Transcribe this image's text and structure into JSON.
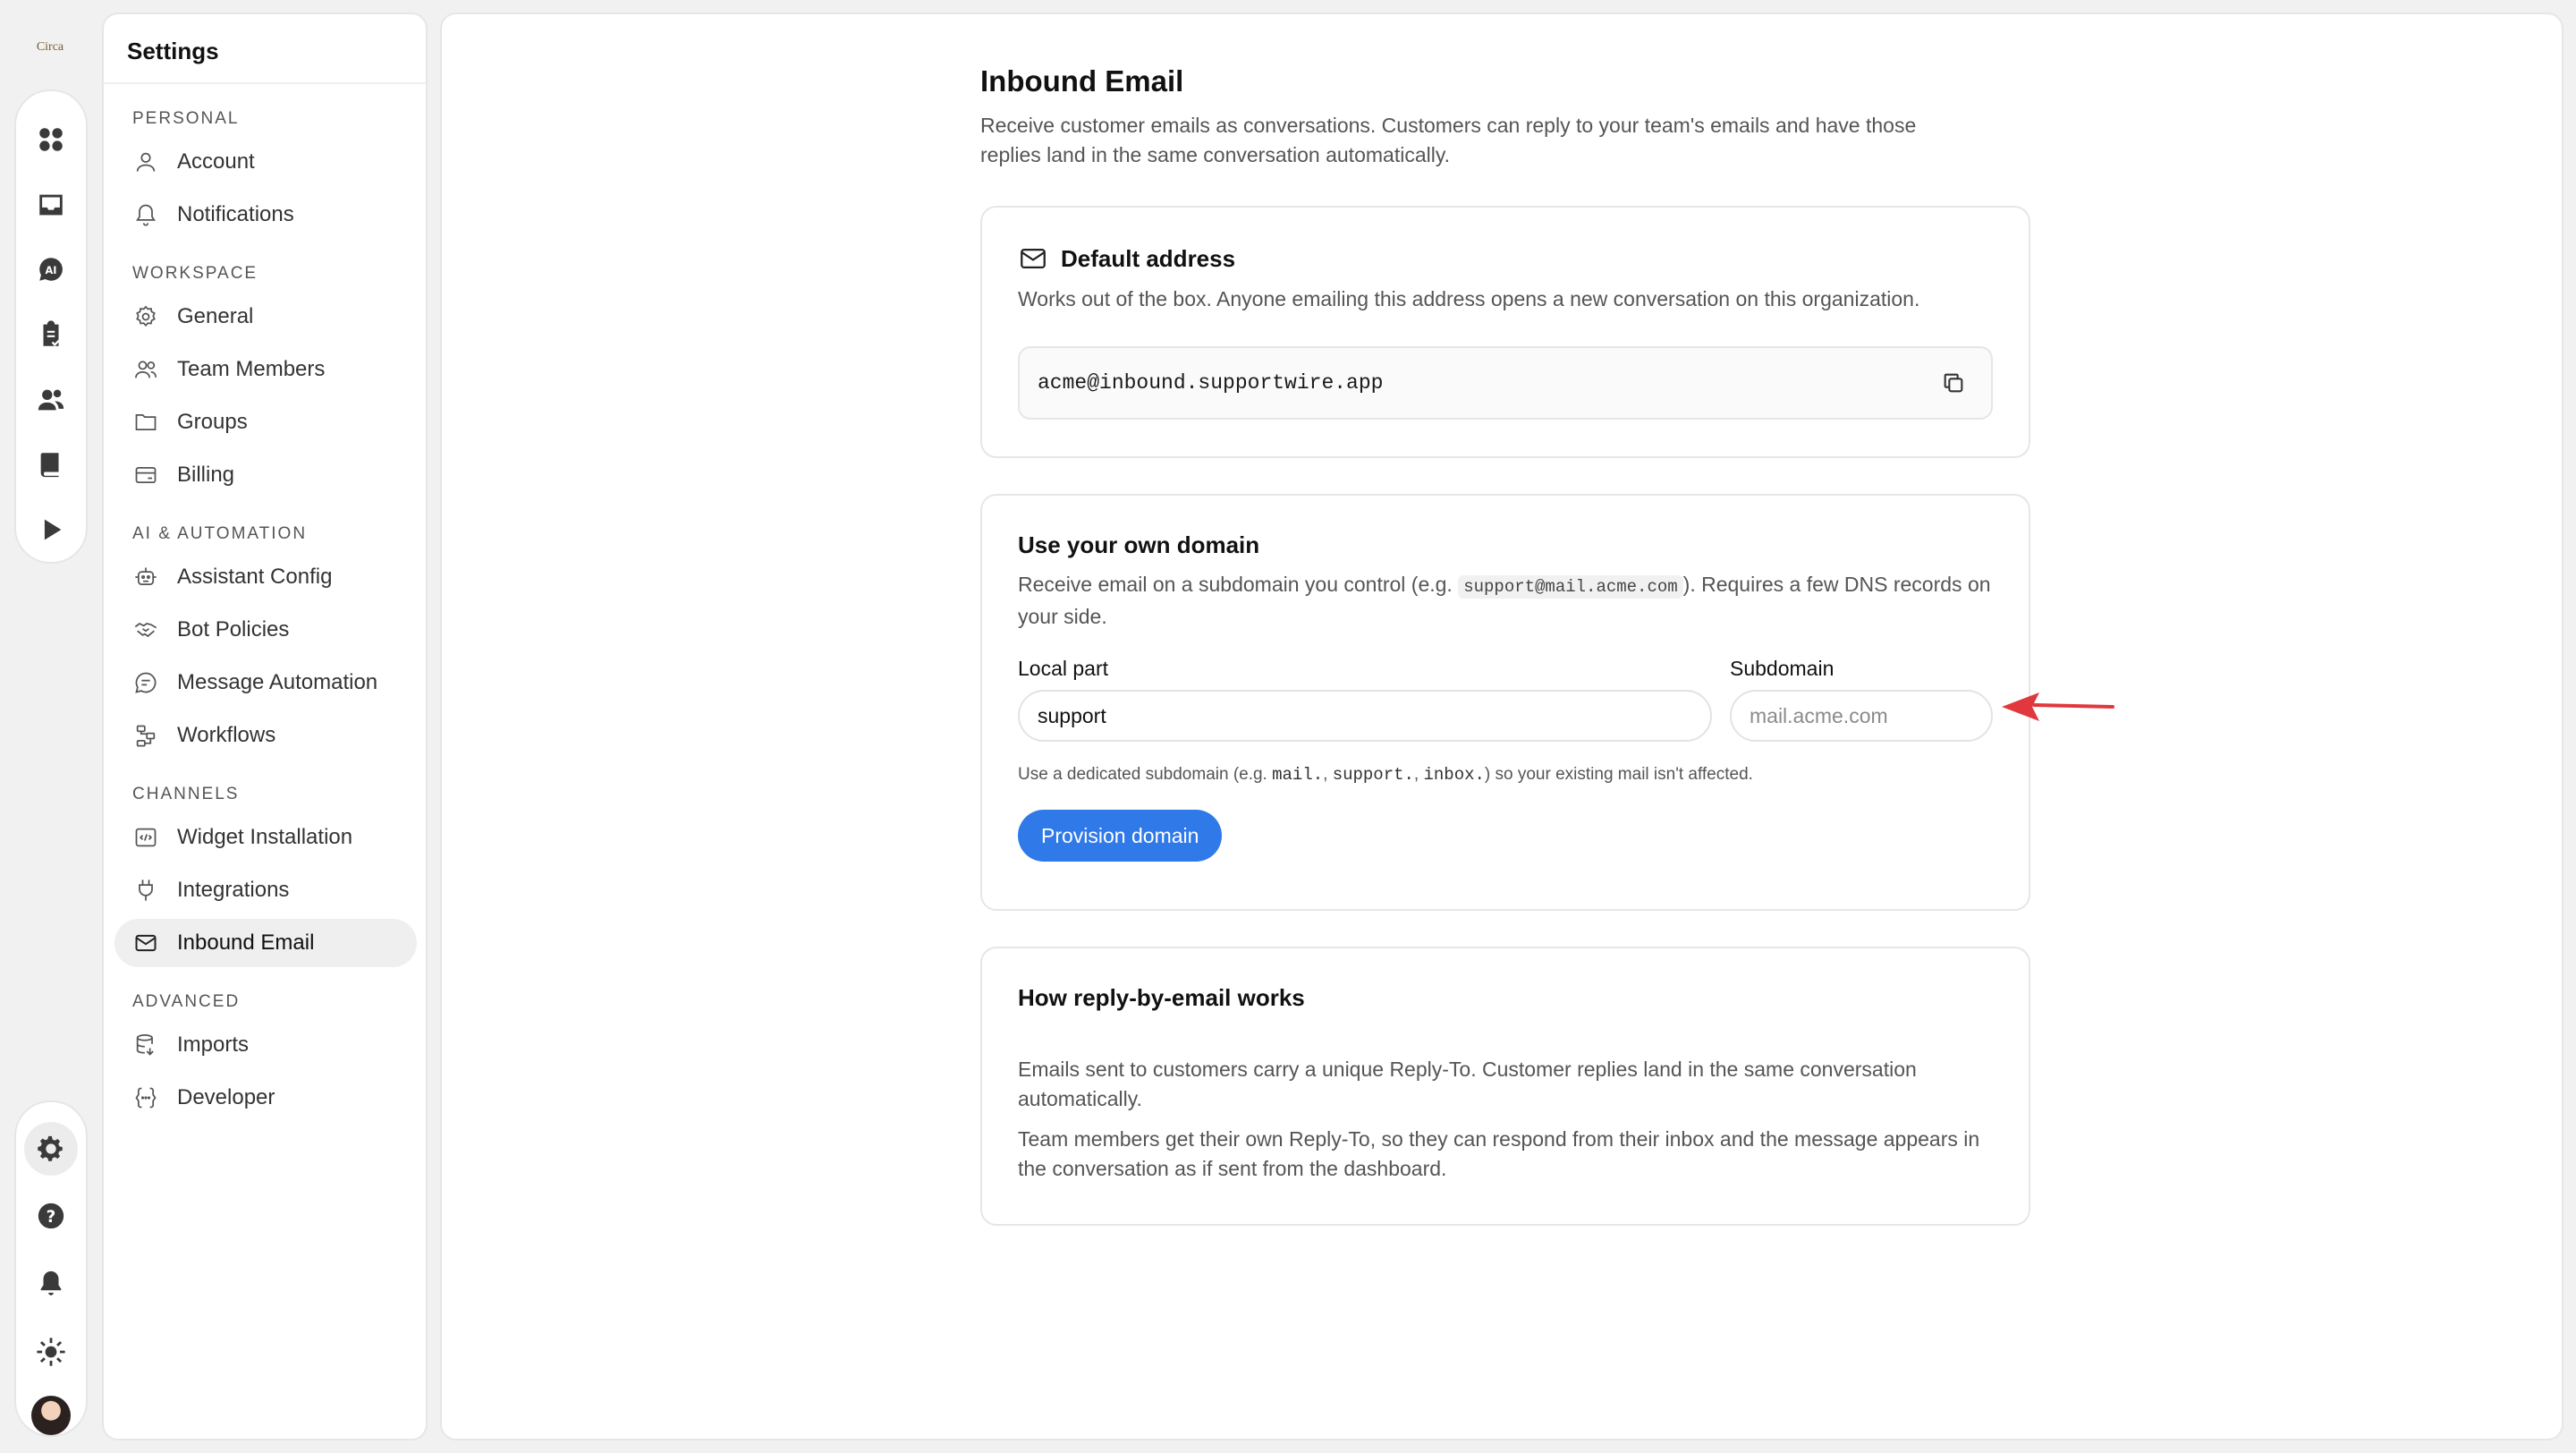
{
  "app": {
    "logo_text": "Circa"
  },
  "rail": {
    "top_icons": [
      "grid-icon",
      "inbox-icon",
      "ai-chat-icon",
      "clipboard-check-icon",
      "users-icon",
      "book-icon",
      "play-icon"
    ],
    "bottom_icons": [
      "gear-icon",
      "help-icon",
      "bell-icon",
      "sun-icon"
    ]
  },
  "sidebar": {
    "title": "Settings",
    "sections": [
      {
        "label": "PERSONAL",
        "items": [
          "Account",
          "Notifications"
        ]
      },
      {
        "label": "WORKSPACE",
        "items": [
          "General",
          "Team Members",
          "Groups",
          "Billing"
        ]
      },
      {
        "label": "AI & AUTOMATION",
        "items": [
          "Assistant Config",
          "Bot Policies",
          "Message Automation",
          "Workflows"
        ]
      },
      {
        "label": "CHANNELS",
        "items": [
          "Widget Installation",
          "Integrations",
          "Inbound Email"
        ]
      },
      {
        "label": "ADVANCED",
        "items": [
          "Imports",
          "Developer"
        ]
      }
    ],
    "active_item": "Inbound Email"
  },
  "page": {
    "title": "Inbound Email",
    "description": "Receive customer emails as conversations. Customers can reply to your team's emails and have those replies land in the same conversation automatically."
  },
  "default_address": {
    "title": "Default address",
    "description": "Works out of the box. Anyone emailing this address opens a new conversation on this organization.",
    "address": "acme@inbound.supportwire.app"
  },
  "own_domain": {
    "title": "Use your own domain",
    "desc_before": "Receive email on a subdomain you control (e.g. ",
    "desc_code": "support@mail.acme.com",
    "desc_after": "). Requires a few DNS records on your side.",
    "local_part_label": "Local part",
    "local_part_value": "support",
    "subdomain_label": "Subdomain",
    "subdomain_placeholder": "mail.acme.com",
    "hint_1": "Use a dedicated subdomain (e.g. ",
    "hint_code_1": "mail.",
    "hint_sep_1": ", ",
    "hint_code_2": "support.",
    "hint_sep_2": ", ",
    "hint_code_3": "inbox.",
    "hint_2": ") so your existing mail isn't affected.",
    "button_label": "Provision domain"
  },
  "how_it_works": {
    "title": "How reply-by-email works",
    "p1": "Emails sent to customers carry a unique Reply-To. Customer replies land in the same conversation automatically.",
    "p2": "Team members get their own Reply-To, so they can respond from their inbox and the message appears in the conversation as if sent from the dashboard."
  },
  "colors": {
    "primary": "#2f79e8",
    "annotation_arrow": "#e0383e"
  }
}
